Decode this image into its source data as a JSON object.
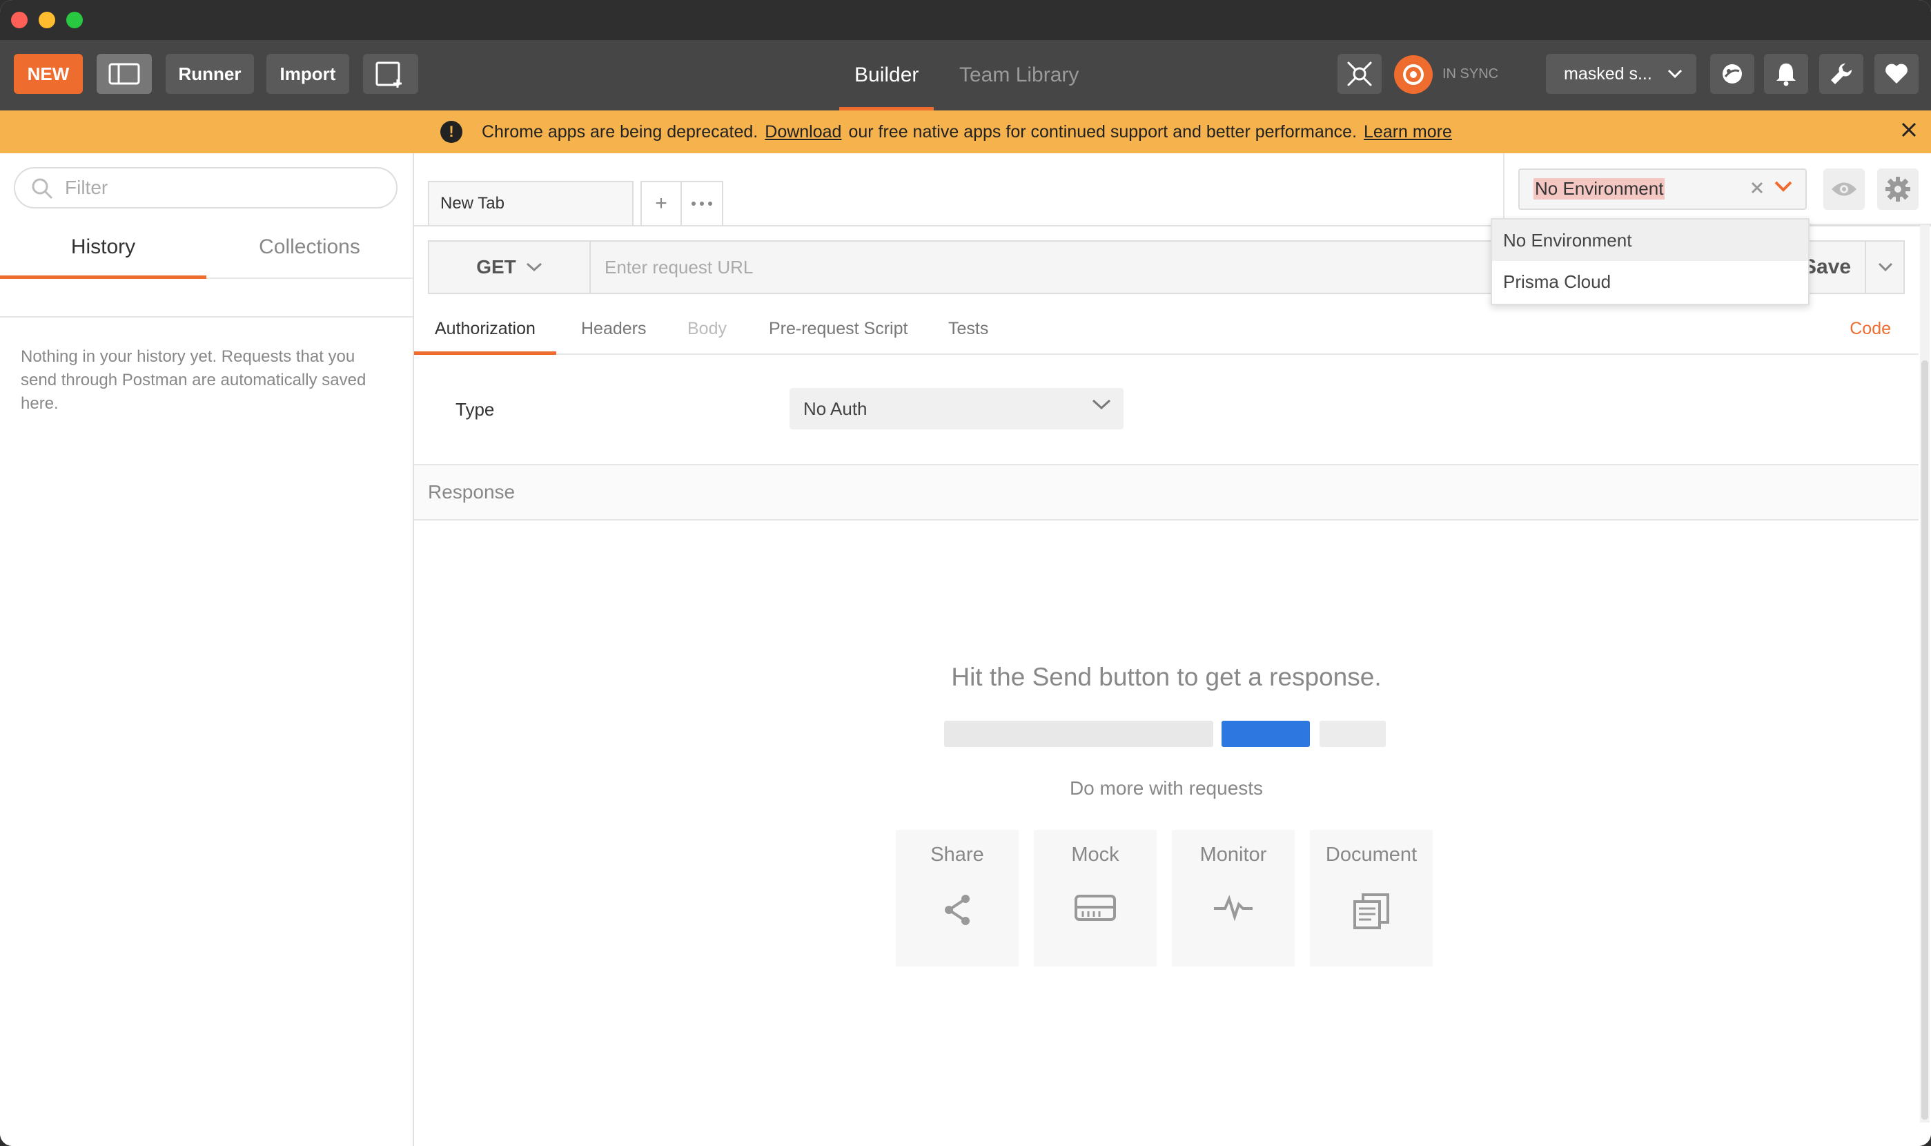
{
  "header": {
    "new_label": "NEW",
    "runner_label": "Runner",
    "import_label": "Import",
    "tab_builder": "Builder",
    "tab_team_library": "Team Library",
    "sync_status": "IN SYNC",
    "user_label": "masked s..."
  },
  "banner": {
    "text_before": "Chrome apps are being deprecated.",
    "download_link": "Download",
    "text_after": "our free native apps for continued support and better performance.",
    "learn_more_link": "Learn more"
  },
  "sidebar": {
    "filter_placeholder": "Filter",
    "tabs": [
      {
        "label": "History",
        "active": true
      },
      {
        "label": "Collections",
        "active": false
      }
    ],
    "empty_message": "Nothing in your history yet. Requests that you send through Postman are automatically saved here."
  },
  "request": {
    "tab_title": "New Tab",
    "method": "GET",
    "url_placeholder": "Enter request URL",
    "save_label": "Save",
    "subtabs": [
      "Authorization",
      "Headers",
      "Body",
      "Pre-request Script",
      "Tests"
    ],
    "code_link": "Code",
    "auth_type_label": "Type",
    "auth_type_value": "No Auth"
  },
  "response": {
    "title": "Response",
    "hint": "Hit the Send button to get a response.",
    "do_more": "Do more with requests",
    "cards": [
      "Share",
      "Mock",
      "Monitor",
      "Document"
    ]
  },
  "environment": {
    "selected": "No Environment",
    "options": [
      "No Environment",
      "Prisma Cloud"
    ]
  },
  "icons": [
    "search-icon",
    "sidebar-toggle-icon",
    "new-window-icon",
    "interceptor-icon",
    "sync-icon",
    "chevron-down-icon",
    "satellite-icon",
    "bell-icon",
    "wrench-icon",
    "heart-icon",
    "warning-icon",
    "close-icon",
    "plus-icon",
    "more-icon",
    "eye-icon",
    "gear-icon",
    "share-icon",
    "mock-icon",
    "monitor-icon",
    "document-icon"
  ],
  "colors": {
    "accent": "#ef6c2f",
    "banner": "#f6b24c",
    "header": "#464646",
    "send_blue": "#2d78e0"
  }
}
